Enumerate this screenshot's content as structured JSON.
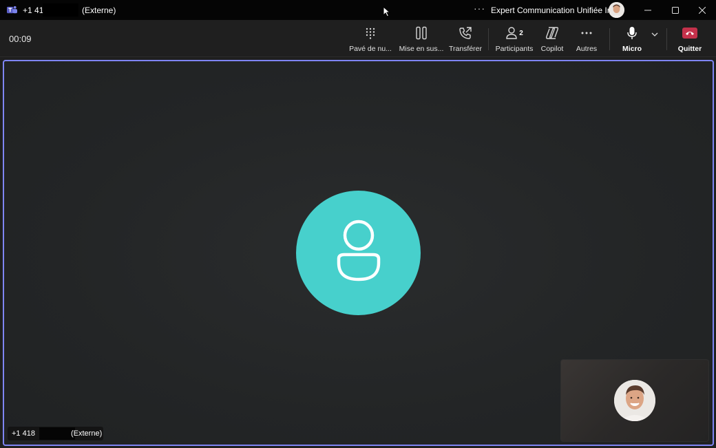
{
  "titlebar": {
    "caller_number": "+1 41",
    "caller_tag": "(Externe)",
    "more_label": "···",
    "org_name": "Expert Communication Unifiée Inc"
  },
  "toolbar": {
    "timer": "00:09",
    "buttons": [
      {
        "label": "Pavé de nu...",
        "icon": "dialpad-icon"
      },
      {
        "label": "Mise en sus...",
        "icon": "hold-icon"
      },
      {
        "label": "Transférer",
        "icon": "transfer-icon"
      },
      {
        "label": "Participants",
        "icon": "participants-icon",
        "badge": "2"
      },
      {
        "label": "Copilot",
        "icon": "copilot-icon"
      },
      {
        "label": "Autres",
        "icon": "more-icon"
      },
      {
        "label": "Micro",
        "icon": "microphone-icon"
      },
      {
        "label": "Quitter",
        "icon": "hangup-icon"
      }
    ]
  },
  "stage": {
    "participant_number": "+1 418",
    "participant_tag": "(Externe)"
  },
  "colors": {
    "accent": "#7f85f5",
    "avatar_bg": "#47d0cc",
    "hangup": "#c4314b"
  }
}
